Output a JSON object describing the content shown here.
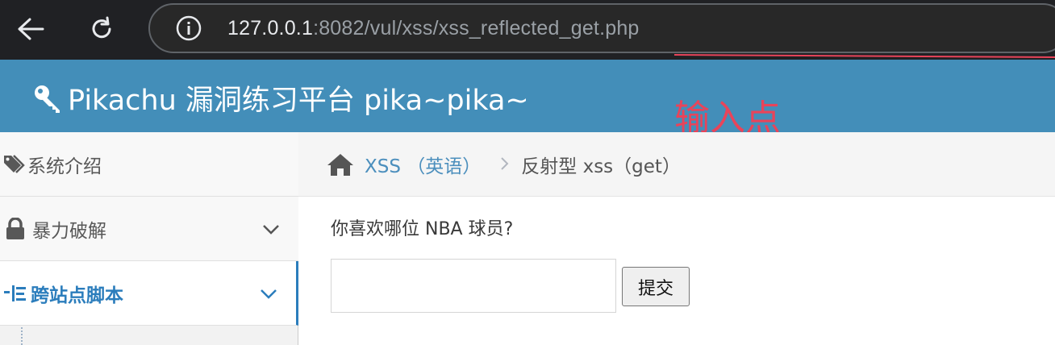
{
  "browser": {
    "url_host": "127.0.0.1",
    "url_rest": ":8082/vul/xss/xss_reflected_get.php"
  },
  "header": {
    "title": "Pikachu 漏洞练习平台 pika~pika~"
  },
  "annotation": {
    "text": "输入点",
    "color": "#e8445a"
  },
  "sidebar": {
    "items": [
      {
        "label": "系统介绍",
        "icon": "tags-icon"
      },
      {
        "label": "暴力破解",
        "icon": "lock-icon"
      },
      {
        "label": "跨站点脚本",
        "icon": "list-icon",
        "active": true
      }
    ]
  },
  "breadcrumb": {
    "link": "XSS （英语）",
    "current": "反射型 xss（get）"
  },
  "form": {
    "question": "你喜欢哪位 NBA 球员?",
    "input_value": "",
    "submit_label": "提交"
  },
  "colors": {
    "header_blue": "#438eb9",
    "link_blue": "#4c8fbd",
    "active_blue": "#2b7dbc"
  }
}
